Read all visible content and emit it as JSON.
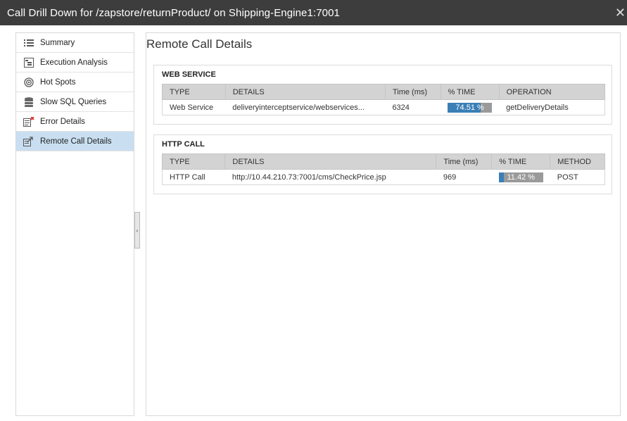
{
  "window": {
    "title": "Call Drill Down for /zapstore/returnProduct/ on Shipping-Engine1:7001",
    "close_glyph": "✕"
  },
  "sidebar": {
    "items": [
      {
        "label": "Summary",
        "icon": "list-icon",
        "active": false
      },
      {
        "label": "Execution Analysis",
        "icon": "tree-icon",
        "active": false
      },
      {
        "label": "Hot Spots",
        "icon": "target-icon",
        "active": false
      },
      {
        "label": "Slow SQL Queries",
        "icon": "database-icon",
        "active": false
      },
      {
        "label": "Error Details",
        "icon": "error-doc-icon",
        "active": false
      },
      {
        "label": "Remote Call Details",
        "icon": "external-link-icon",
        "active": true
      }
    ],
    "collapse_glyph": "‹"
  },
  "main": {
    "page_title": "Remote Call Details",
    "web_service": {
      "title": "WEB SERVICE",
      "headers": [
        "TYPE",
        "DETAILS",
        "Time (ms)",
        "% TIME",
        "OPERATION"
      ],
      "rows": [
        {
          "type": "Web Service",
          "details": "deliveryinterceptservice/webservices...",
          "time": "6324",
          "pct_label": "74.51 %",
          "pct": 74.51,
          "operation": "getDeliveryDetails"
        }
      ]
    },
    "http_call": {
      "title": "HTTP CALL",
      "headers": [
        "TYPE",
        "DETAILS",
        "Time (ms)",
        "% TIME",
        "METHOD"
      ],
      "rows": [
        {
          "type": "HTTP Call",
          "details": "http://10.44.210.73:7001/cms/CheckPrice.jsp",
          "time": "969",
          "pct_label": "11.42 %",
          "pct": 11.42,
          "method": "POST"
        }
      ]
    }
  },
  "colors": {
    "titlebar": "#3d3d3d",
    "active_nav": "#c9dff1",
    "bar_fill": "#3a7fb6",
    "bar_track": "#9a9a9a"
  }
}
